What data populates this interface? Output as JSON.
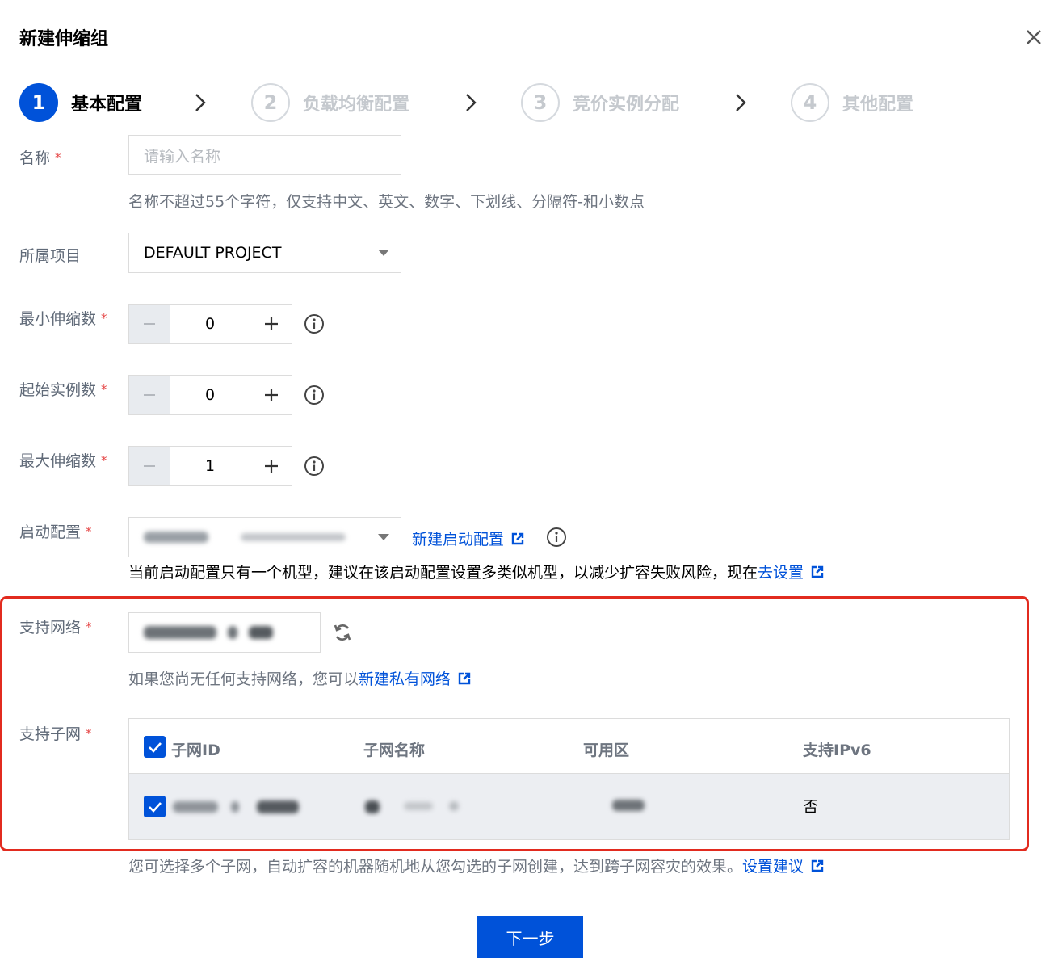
{
  "dialog": {
    "title": "新建伸缩组"
  },
  "steps": [
    {
      "number": "1",
      "label": "基本配置",
      "active": true
    },
    {
      "number": "2",
      "label": "负载均衡配置",
      "active": false
    },
    {
      "number": "3",
      "label": "竞价实例分配",
      "active": false
    },
    {
      "number": "4",
      "label": "其他配置",
      "active": false
    }
  ],
  "form": {
    "name": {
      "label": "名称",
      "required": "*",
      "placeholder": "请输入名称",
      "hint": "名称不超过55个字符，仅支持中文、英文、数字、下划线、分隔符-和小数点"
    },
    "project": {
      "label": "所属项目",
      "value": "DEFAULT PROJECT"
    },
    "min_size": {
      "label": "最小伸缩数",
      "required": "*",
      "value": "0"
    },
    "initial_size": {
      "label": "起始实例数",
      "required": "*",
      "value": "0"
    },
    "max_size": {
      "label": "最大伸缩数",
      "required": "*",
      "value": "1"
    },
    "launch_config": {
      "label": "启动配置",
      "required": "*",
      "new_link": "新建启动配置",
      "warning": "当前启动配置只有一个机型，建议在该启动配置设置多类似机型，以减少扩容失败风险，现在",
      "warning_link": "去设置"
    },
    "vpc": {
      "label": "支持网络",
      "required": "*",
      "hint": "如果您尚无任何支持网络，您可以",
      "hint_link": "新建私有网络"
    },
    "subnet": {
      "label": "支持子网",
      "required": "*",
      "columns": [
        "子网ID",
        "子网名称",
        "可用区",
        "支持IPv6"
      ],
      "rows": [
        {
          "ipv6": "否"
        }
      ],
      "hint": "您可选择多个子网，自动扩容的机器随机地从您勾选的子网创建，达到跨子网容灾的效果。",
      "hint_link": "设置建议"
    }
  },
  "footer": {
    "next_label": "下一步"
  },
  "colors": {
    "primary": "#0052d9",
    "highlight": "#e22b1f",
    "required": "#e54545"
  }
}
